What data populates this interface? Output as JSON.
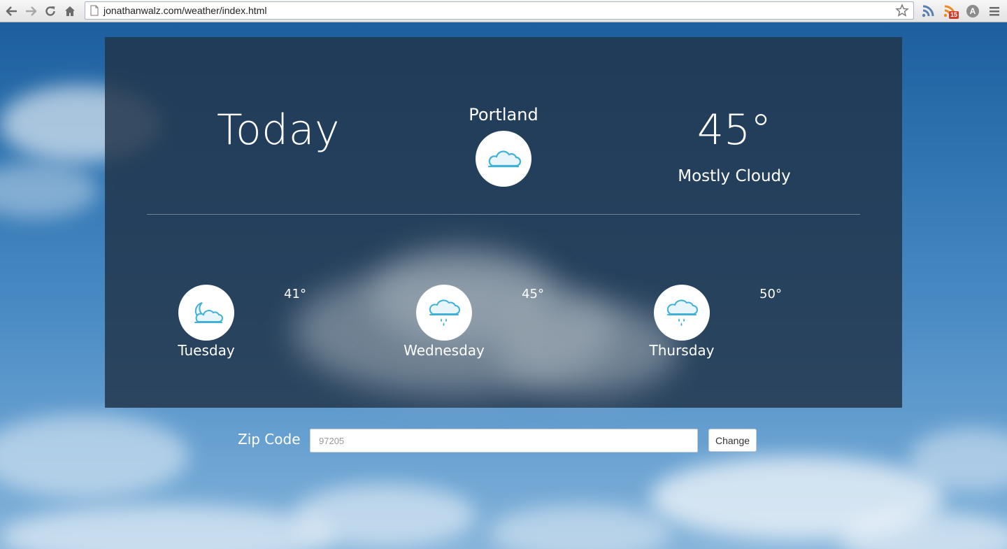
{
  "browser": {
    "url": "jonathanwalz.com/weather/index.html",
    "rss_badge_count": "15"
  },
  "today": {
    "title": "Today",
    "city": "Portland",
    "temperature": "45°",
    "condition": "Mostly Cloudy",
    "icon": "cloud-icon"
  },
  "forecast": [
    {
      "day": "Tuesday",
      "temperature": "41°",
      "icon": "moon-cloud-icon"
    },
    {
      "day": "Wednesday",
      "temperature": "45°",
      "icon": "rain-cloud-icon"
    },
    {
      "day": "Thursday",
      "temperature": "50°",
      "icon": "rain-cloud-icon"
    }
  ],
  "zip_form": {
    "label": "Zip Code",
    "placeholder": "97205",
    "button_label": "Change"
  },
  "colors": {
    "panel_bg": "#21344a",
    "icon_blue": "#3fb0d8",
    "sky_top": "#1d5f9e",
    "sky_bottom": "#86b4da"
  }
}
